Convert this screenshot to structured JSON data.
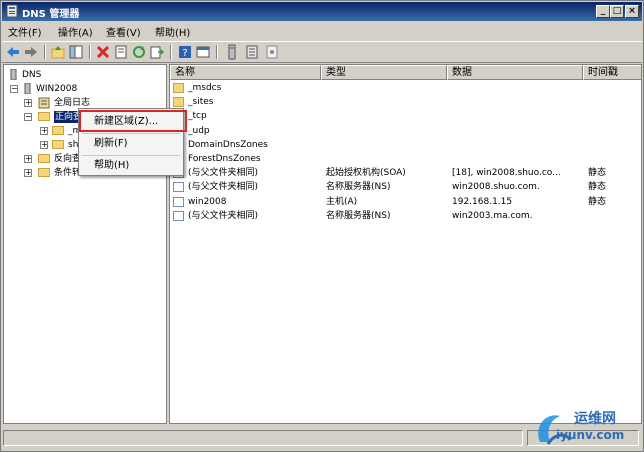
{
  "window": {
    "title": "DNS 管理器"
  },
  "titlebar": {
    "minimize": "_",
    "maximize": "□",
    "close": "×"
  },
  "menu": {
    "items": [
      "文件(F)",
      "操作(A)",
      "查看(V)",
      "帮助(H)"
    ]
  },
  "toolbar": {
    "buttons": [
      "back-icon",
      "forward-icon",
      "up-folder-icon",
      "show-tree-icon",
      "delete-icon",
      "properties-icon",
      "refresh-icon",
      "export-icon",
      "help-icon",
      "console-icon",
      "server-icon",
      "server-list-icon",
      "record-icon"
    ]
  },
  "tree": {
    "root": "DNS",
    "server": "WIN2008",
    "global_logs": "全局日志",
    "forward_zones": "正向查找区域",
    "forward_child_1": "_m",
    "forward_child_2": "sh",
    "reverse_zones": "反向查",
    "conditional": "条件转"
  },
  "list": {
    "columns": [
      "名称",
      "类型",
      "数据",
      "时间戳"
    ],
    "rows": [
      {
        "name": "_msdcs",
        "type": "",
        "data": "",
        "ts": "",
        "icon": "folder-icon"
      },
      {
        "name": "_sites",
        "type": "",
        "data": "",
        "ts": "",
        "icon": "folder-icon"
      },
      {
        "name": "_tcp",
        "type": "",
        "data": "",
        "ts": "",
        "icon": "folder-icon"
      },
      {
        "name": "_udp",
        "type": "",
        "data": "",
        "ts": "",
        "icon": "folder-icon"
      },
      {
        "name": "DomainDnsZones",
        "type": "",
        "data": "",
        "ts": "",
        "icon": "folder-icon"
      },
      {
        "name": "ForestDnsZones",
        "type": "",
        "data": "",
        "ts": "",
        "icon": "folder-icon"
      },
      {
        "name": "(与父文件夹相同)",
        "type": "起始授权机构(SOA)",
        "data": "[18], win2008.shuo.co...",
        "ts": "静态",
        "icon": "record-icon"
      },
      {
        "name": "(与父文件夹相同)",
        "type": "名称服务器(NS)",
        "data": "win2008.shuo.com.",
        "ts": "静态",
        "icon": "record-icon"
      },
      {
        "name": "win2008",
        "type": "主机(A)",
        "data": "192.168.1.15",
        "ts": "静态",
        "icon": "record-icon"
      },
      {
        "name": "(与父文件夹相同)",
        "type": "名称服务器(NS)",
        "data": "win2003.ma.com.",
        "ts": "",
        "icon": "record-icon"
      }
    ]
  },
  "context_menu": {
    "items": [
      "新建区域(Z)...",
      "刷新(F)",
      "帮助(H)"
    ]
  },
  "watermark": {
    "cn": "运维网",
    "en": "iyunv.com"
  }
}
